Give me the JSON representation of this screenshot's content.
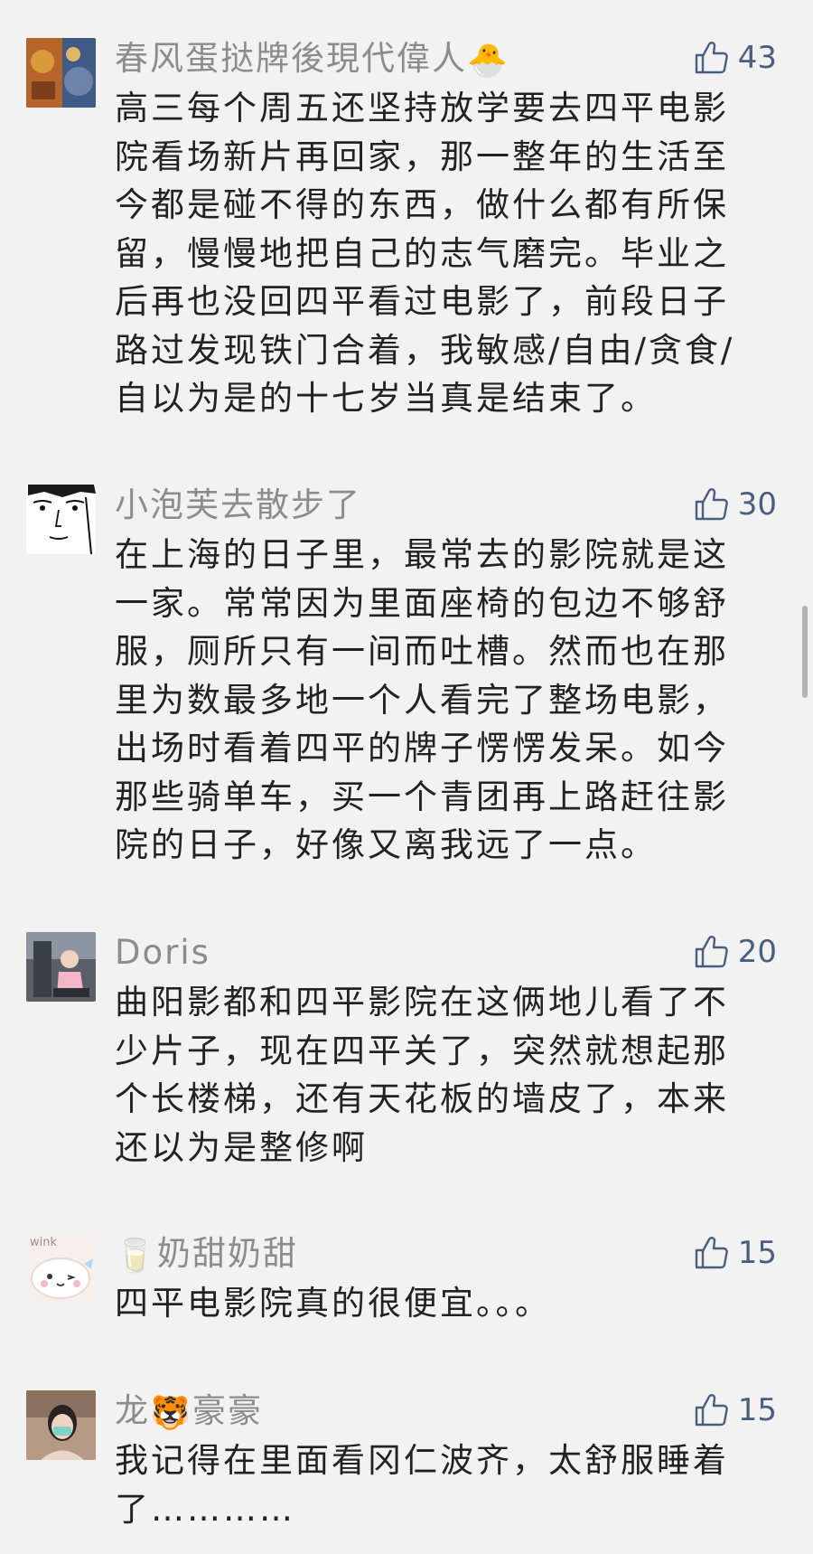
{
  "comments": [
    {
      "username": "春风蛋挞牌後現代偉人",
      "username_emoji": "🐣",
      "likes": "43",
      "text": "高三每个周五还坚持放学要去四平电影\n院看场新片再回家，那一整年的生活至\n今都是碰不得的东西，做什么都有所保\n留，慢慢地把自己的志气磨完。毕业之\n后再也没回四平看过电影了，前段日子\n路过发现铁门合着，我敏感/自由/贪食/\n自以为是的十七岁当真是结束了。"
    },
    {
      "username": "小泡芙去散步了",
      "likes": "30",
      "text": "在上海的日子里，最常去的影院就是这\n一家。常常因为里面座椅的包边不够舒\n服，厕所只有一间而吐槽。然而也在那\n里为数最多地一个人看完了整场电影，\n出场时看着四平的牌子愣愣发呆。如今\n那些骑单车，买一个青团再上路赶往影\n院的日子，好像又离我远了一点。"
    },
    {
      "username": "Doris",
      "likes": "20",
      "text": "曲阳影都和四平影院在这俩地儿看了不\n少片子，现在四平关了，突然就想起那\n个长楼梯，还有天花板的墙皮了，本来\n还以为是整修啊"
    },
    {
      "username_emoji_before": "🥛",
      "username": "奶甜奶甜",
      "likes": "15",
      "text": "四平电影院真的很便宜。。。"
    },
    {
      "username_part1": "龙",
      "username_emoji_mid": "🐯",
      "username_part2": "豪豪",
      "likes": "15",
      "text": "我记得在里面看冈仁波齐，太舒服睡着\n了…………"
    }
  ],
  "icons": {
    "like": "thumbs-up-icon"
  },
  "colors": {
    "background": "#f2f2f2",
    "username": "#8c8c8c",
    "body_text": "#222222",
    "like": "#4a5f7e"
  }
}
